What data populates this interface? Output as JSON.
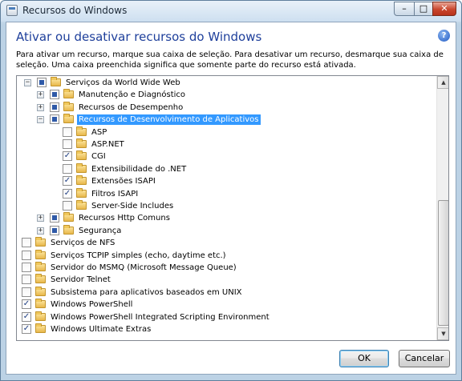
{
  "window": {
    "title": "Recursos do Windows",
    "controls": {
      "minimize": "–",
      "maximize": "□",
      "close": "✕"
    }
  },
  "header": {
    "heading": "Ativar ou desativar recursos do Windows",
    "help_icon": "?",
    "description": "Para ativar um recurso, marque sua caixa de seleção. Para desativar um recurso, desmarque sua caixa de seleção. Uma caixa preenchida significa que somente parte do recurso está ativada."
  },
  "tree": {
    "items": [
      {
        "label": "Serviços da World Wide Web",
        "state": "partial",
        "expander": "−"
      },
      {
        "label": "Manutenção e Diagnóstico",
        "state": "partial",
        "expander": "+"
      },
      {
        "label": "Recursos de Desempenho",
        "state": "partial",
        "expander": "+"
      },
      {
        "label": "Recursos de Desenvolvimento de Aplicativos",
        "state": "partial",
        "expander": "−",
        "selected": true
      },
      {
        "label": "ASP",
        "state": "unchecked"
      },
      {
        "label": "ASP.NET",
        "state": "unchecked"
      },
      {
        "label": "CGI",
        "state": "checked"
      },
      {
        "label": "Extensibilidade do .NET",
        "state": "unchecked"
      },
      {
        "label": "Extensões ISAPI",
        "state": "checked"
      },
      {
        "label": "Filtros ISAPI",
        "state": "checked"
      },
      {
        "label": "Server-Side Includes",
        "state": "unchecked"
      },
      {
        "label": "Recursos Http Comuns",
        "state": "partial",
        "expander": "+"
      },
      {
        "label": "Segurança",
        "state": "partial",
        "expander": "+"
      },
      {
        "label": "Serviços de NFS",
        "state": "unchecked",
        "expander": "+"
      },
      {
        "label": "Serviços TCPIP simples (echo, daytime etc.)",
        "state": "unchecked"
      },
      {
        "label": "Servidor do MSMQ (Microsoft Message Queue)",
        "state": "unchecked",
        "expander": "+"
      },
      {
        "label": "Servidor Telnet",
        "state": "unchecked"
      },
      {
        "label": "Subsistema para aplicativos baseados em UNIX",
        "state": "unchecked"
      },
      {
        "label": "Windows PowerShell",
        "state": "checked"
      },
      {
        "label": "Windows PowerShell Integrated Scripting Environment",
        "state": "checked"
      },
      {
        "label": "Windows Ultimate Extras",
        "state": "checked"
      }
    ],
    "check_glyph": "✓",
    "scroll_up_glyph": "▲",
    "scroll_down_glyph": "▼"
  },
  "buttons": {
    "ok": "OK",
    "cancel": "Cancelar"
  },
  "colors": {
    "heading": "#1e3f9b",
    "selection": "#3399ff",
    "close_button": "#c9462d"
  }
}
